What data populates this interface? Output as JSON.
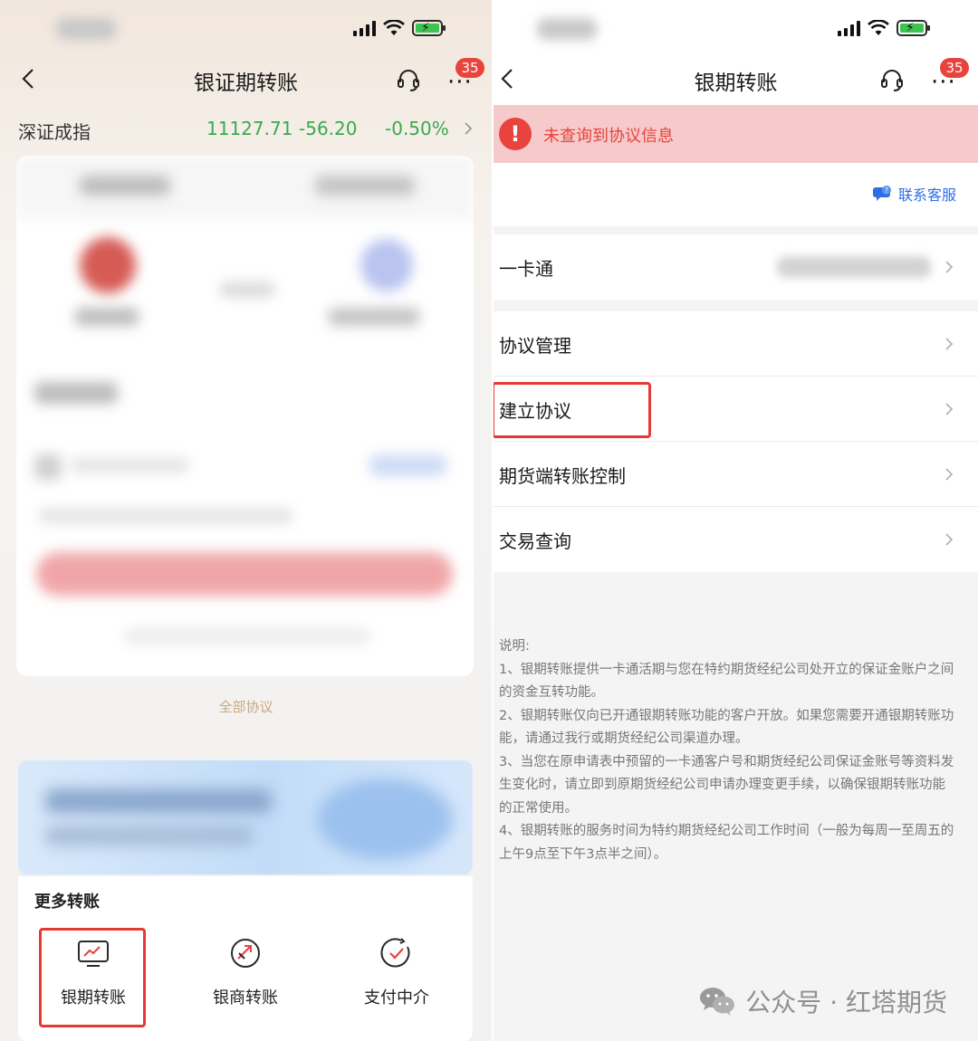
{
  "left": {
    "nav": {
      "title": "银证期转账",
      "badge": "35"
    },
    "ticker": {
      "name": "深证成指",
      "value": "11127.71",
      "change": "-56.20",
      "percent": "-0.50%"
    },
    "all_agreements_link": "全部协议",
    "more_transfer": {
      "title": "更多转账",
      "items": [
        {
          "label": "银期转账",
          "icon": "chart-card-icon"
        },
        {
          "label": "银商转账",
          "icon": "transfer-arrows-icon"
        },
        {
          "label": "支付中介",
          "icon": "check-circle-icon"
        }
      ]
    }
  },
  "right": {
    "nav": {
      "title": "银期转账",
      "badge": "35"
    },
    "error": {
      "text": "未查询到协议信息"
    },
    "contact": {
      "label": "联系客服"
    },
    "card": {
      "label": "一卡通"
    },
    "menu": [
      {
        "label": "协议管理"
      },
      {
        "label": "建立协议"
      },
      {
        "label": "期货端转账控制"
      },
      {
        "label": "交易查询"
      }
    ],
    "notes": {
      "heading": "说明:",
      "items": [
        "1、银期转账提供一卡通活期与您在特约期货经纪公司处开立的保证金账户之间的资金互转功能。",
        "2、银期转账仅向已开通银期转账功能的客户开放。如果您需要开通银期转账功能，请通过我行或期货经纪公司渠道办理。",
        "3、当您在原申请表中预留的一卡通客户号和期货经纪公司保证金账号等资料发生变化时，请立即到原期货经纪公司申请办理变更手续，以确保银期转账功能的正常使用。",
        "4、银期转账的服务时间为特约期货经纪公司工作时间（一般为每周一至周五的上午9点至下午3点半之间）。"
      ]
    }
  },
  "watermark": "公众号 · 红塔期货",
  "colors": {
    "accent_red": "#e53935",
    "link_blue": "#2f6fe4",
    "ticker_green": "#39a94e",
    "error_bg": "#f6caca",
    "gold_link": "#c6a980"
  }
}
